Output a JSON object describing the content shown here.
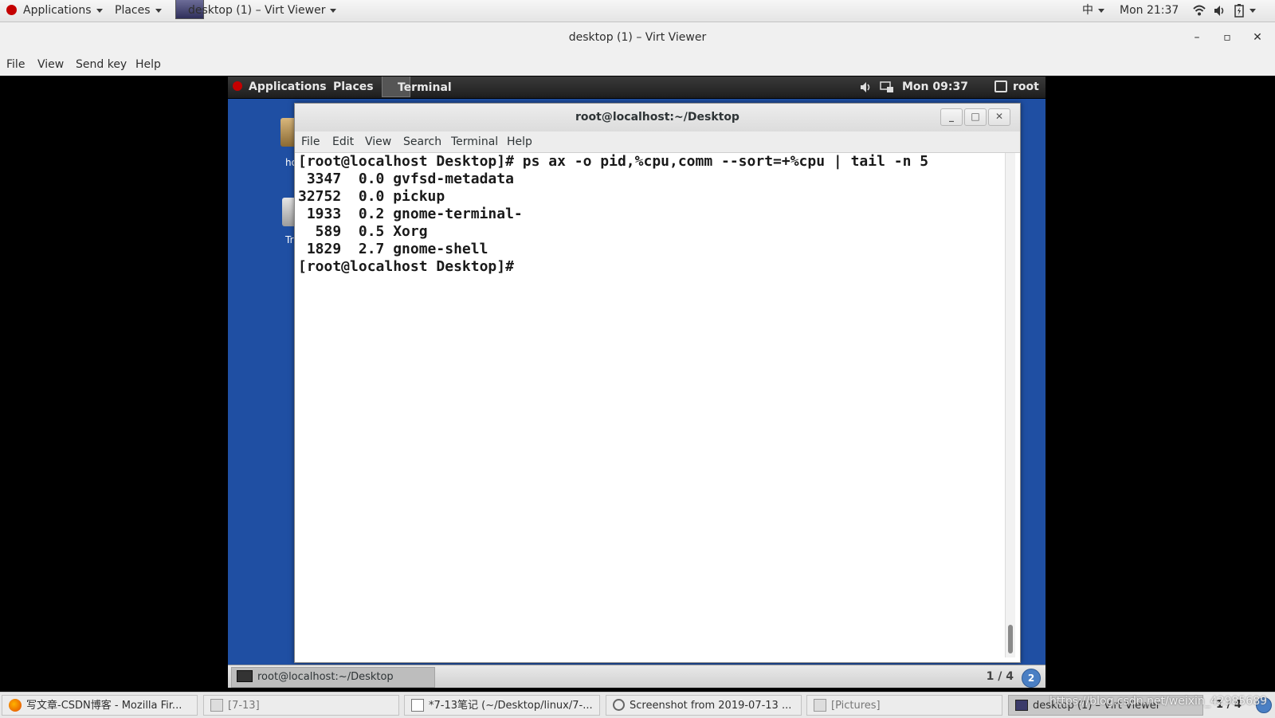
{
  "host_panel": {
    "applications": "Applications",
    "places": "Places",
    "active_window": "desktop (1) – Virt Viewer",
    "input_method": "中",
    "clock": "Mon 21:37"
  },
  "viewer": {
    "title": "desktop (1) – Virt Viewer",
    "menu": [
      "File",
      "View",
      "Send key",
      "Help"
    ]
  },
  "guest_panel": {
    "applications": "Applications",
    "places": "Places",
    "active_app": "Terminal",
    "clock": "Mon 09:37",
    "user": "root"
  },
  "desktop_icons": [
    "ho",
    "Tr"
  ],
  "terminal": {
    "title": "root@localhost:~/Desktop",
    "menu": [
      "File",
      "Edit",
      "View",
      "Search",
      "Terminal",
      "Help"
    ],
    "lines": [
      "[root@localhost Desktop]# ps ax -o pid,%cpu,comm --sort=+%cpu | tail -n 5",
      " 3347  0.0 gvfsd-metadata",
      "32752  0.0 pickup",
      " 1933  0.2 gnome-terminal-",
      "  589  0.5 Xorg",
      " 1829  2.7 gnome-shell",
      "[root@localhost Desktop]# "
    ]
  },
  "guest_bottom": {
    "task": "root@localhost:~/Desktop",
    "workspace": "1 / 4",
    "badge": "2"
  },
  "host_taskbar": {
    "tasks": [
      {
        "label": "写文章-CSDN博客 - Mozilla Fir...",
        "icon": "firefox-icon"
      },
      {
        "label": "[7-13]",
        "icon": "window-icon"
      },
      {
        "label": "*7-13笔记 (~/Desktop/linux/7-...",
        "icon": "text-editor-icon"
      },
      {
        "label": "Screenshot from 2019-07-13 ...",
        "icon": "image-viewer-icon"
      },
      {
        "label": "[Pictures]",
        "icon": "window-icon"
      },
      {
        "label": "desktop (1) – Virt Viewer",
        "icon": "virt-viewer-icon"
      }
    ],
    "workspace": "1 / 4"
  },
  "watermark": "https://blog.csdn.net/weixin_42985689",
  "colors": {
    "guest_background": "#1f4fa3",
    "redhat_red": "#c40000"
  }
}
